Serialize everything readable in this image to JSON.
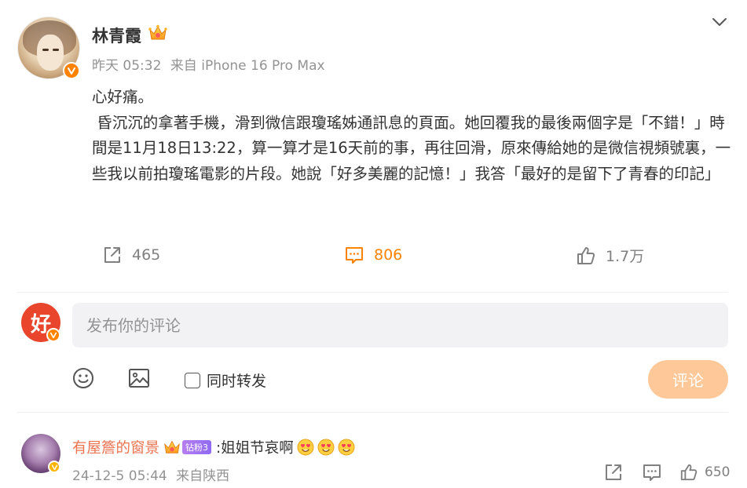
{
  "post": {
    "username": "林青霞",
    "time": "昨天 05:32",
    "source": "来自 iPhone 16 Pro Max",
    "content": [
      "心好痛。",
      " 昏沉沉的拿著手機，滑到微信跟瓊瑤姊通訊息的頁面。她回覆我的最後兩個字是「不錯！」時間是11月18日13:22，算一算才是16天前的事，再往回滑，原來傳給她的是微信視頻號裏，一些我以前拍瓊瑤電影的片段。她說「好多美麗的記憶！」我答「最好的是留下了青春的印記」"
    ],
    "share_count": "465",
    "comment_count": "806",
    "like_count": "1.7万"
  },
  "composer": {
    "avatar_char": "好",
    "placeholder": "发布你的评论",
    "repost_label": "同时转发",
    "submit_label": "评论"
  },
  "comment": {
    "username": "有屋簷的窗景",
    "fan_badge": "钻粉3",
    "text": ":姐姐节哀啊",
    "emoji_count": 3,
    "date": "24-12-5 05:44",
    "location": "来自陕西",
    "like_count": "650"
  },
  "colors": {
    "accent": "#ff8200",
    "commenter_name": "#eb7350",
    "submit_bg": "#ffc898",
    "input_bg": "#f2f2f4",
    "muted": "#939393"
  },
  "icons": [
    "chevron-down-icon",
    "crown-icon",
    "verified-icon",
    "share-icon",
    "comment-icon",
    "like-icon",
    "emoji-icon",
    "image-icon",
    "checkbox",
    "heart-eyes-emoji"
  ]
}
